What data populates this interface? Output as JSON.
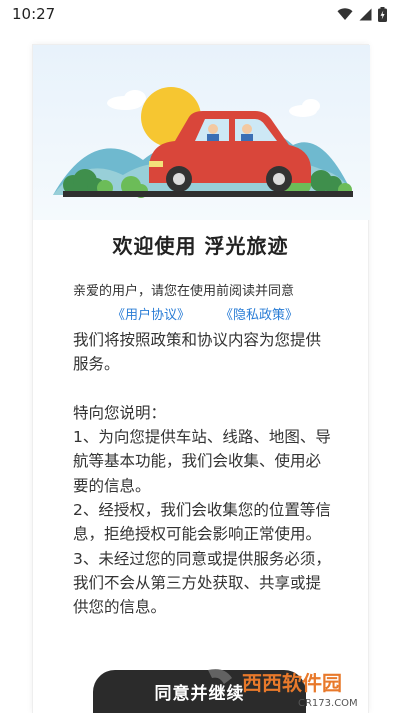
{
  "status_bar": {
    "time": "10:27"
  },
  "dialog": {
    "title": "欢迎使用 浮光旅迹",
    "intro": "亲爱的用户，请您在使用前阅读并同意",
    "user_agreement_link": "《用户协议》",
    "privacy_policy_link": "《隐私政策》",
    "paragraphs": [
      "我们将按照政策和协议内容为您提供服务。",
      "特向您说明：",
      "1、为向您提供车站、线路、地图、导航等基本功能，我们会收集、使用必要的信息。",
      "2、经授权，我们会收集您的位置等信息，拒绝授权可能会影响正常使用。",
      "3、未经过您的同意或提供服务必须，我们不会从第三方处获取、共享或提供您的信息。"
    ],
    "agree_button": "同意并继续"
  },
  "watermark": {
    "brand": "西西软件园",
    "url": "CR173.COM"
  },
  "colors": {
    "link": "#2a7dd6",
    "button": "#2b2b2b",
    "car": "#d9463a"
  }
}
